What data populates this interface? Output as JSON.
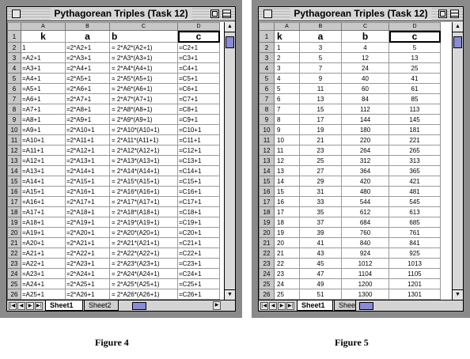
{
  "figures": [
    {
      "caption": "Figure 4",
      "window_title": "Pythagorean Triples (Task 12)",
      "column_letters": [
        "A",
        "B",
        "C",
        "D"
      ],
      "header_labels": [
        "k",
        "a",
        "b",
        "c"
      ],
      "tabs": [
        "Sheet1",
        "Sheet2"
      ],
      "rows": [
        [
          "1",
          "=2*A2+1",
          "= 2*A2*(A2+1)",
          "=C2+1"
        ],
        [
          "=A2+1",
          "=2*A3+1",
          "= 2*A3*(A3+1)",
          "=C3+1"
        ],
        [
          "=A3+1",
          "=2*A4+1",
          "= 2*A4*(A4+1)",
          "=C4+1"
        ],
        [
          "=A4+1",
          "=2*A5+1",
          "= 2*A5*(A5+1)",
          "=C5+1"
        ],
        [
          "=A5+1",
          "=2*A6+1",
          "= 2*A6*(A6+1)",
          "=C6+1"
        ],
        [
          "=A6+1",
          "=2*A7+1",
          "= 2*A7*(A7+1)",
          "=C7+1"
        ],
        [
          "=A7+1",
          "=2*A8+1",
          "= 2*A8*(A8+1)",
          "=C8+1"
        ],
        [
          "=A8+1",
          "=2*A9+1",
          "= 2*A9*(A9+1)",
          "=C9+1"
        ],
        [
          "=A9+1",
          "=2*A10+1",
          "= 2*A10*(A10+1)",
          "=C10+1"
        ],
        [
          "=A10+1",
          "=2*A11+1",
          "= 2*A11*(A11+1)",
          "=C11+1"
        ],
        [
          "=A11+1",
          "=2*A12+1",
          "= 2*A12*(A12+1)",
          "=C12+1"
        ],
        [
          "=A12+1",
          "=2*A13+1",
          "= 2*A13*(A13+1)",
          "=C13+1"
        ],
        [
          "=A13+1",
          "=2*A14+1",
          "= 2*A14*(A14+1)",
          "=C14+1"
        ],
        [
          "=A14+1",
          "=2*A15+1",
          "= 2*A15*(A15+1)",
          "=C15+1"
        ],
        [
          "=A15+1",
          "=2*A16+1",
          "= 2*A16*(A16+1)",
          "=C16+1"
        ],
        [
          "=A16+1",
          "=2*A17+1",
          "= 2*A17*(A17+1)",
          "=C17+1"
        ],
        [
          "=A17+1",
          "=2*A18+1",
          "= 2*A18*(A18+1)",
          "=C18+1"
        ],
        [
          "=A18+1",
          "=2*A19+1",
          "= 2*A19*(A19+1)",
          "=C19+1"
        ],
        [
          "=A19+1",
          "=2*A20+1",
          "= 2*A20*(A20+1)",
          "=C20+1"
        ],
        [
          "=A20+1",
          "=2*A21+1",
          "= 2*A21*(A21+1)",
          "=C21+1"
        ],
        [
          "=A21+1",
          "=2*A22+1",
          "= 2*A22*(A22+1)",
          "=C22+1"
        ],
        [
          "=A22+1",
          "=2*A23+1",
          "= 2*A23*(A23+1)",
          "=C23+1"
        ],
        [
          "=A23+1",
          "=2*A24+1",
          "= 2*A24*(A24+1)",
          "=C24+1"
        ],
        [
          "=A24+1",
          "=2*A25+1",
          "= 2*A25*(A25+1)",
          "=C25+1"
        ],
        [
          "=A25+1",
          "=2*A26+1",
          "= 2*A26*(A26+1)",
          "=C26+1"
        ],
        [
          "",
          "",
          "",
          ""
        ]
      ]
    },
    {
      "caption": "Figure 5",
      "window_title": "Pythagorean Triples (Task 12)",
      "column_letters": [
        "A",
        "B",
        "C",
        "D"
      ],
      "header_labels": [
        "k",
        "a",
        "b",
        "c"
      ],
      "tabs": [
        "Sheet1",
        "Sheet"
      ],
      "rows": [
        [
          "1",
          "3",
          "4",
          "5"
        ],
        [
          "2",
          "5",
          "12",
          "13"
        ],
        [
          "3",
          "7",
          "24",
          "25"
        ],
        [
          "4",
          "9",
          "40",
          "41"
        ],
        [
          "5",
          "11",
          "60",
          "61"
        ],
        [
          "6",
          "13",
          "84",
          "85"
        ],
        [
          "7",
          "15",
          "112",
          "113"
        ],
        [
          "8",
          "17",
          "144",
          "145"
        ],
        [
          "9",
          "19",
          "180",
          "181"
        ],
        [
          "10",
          "21",
          "220",
          "221"
        ],
        [
          "11",
          "23",
          "264",
          "265"
        ],
        [
          "12",
          "25",
          "312",
          "313"
        ],
        [
          "13",
          "27",
          "364",
          "365"
        ],
        [
          "14",
          "29",
          "420",
          "421"
        ],
        [
          "15",
          "31",
          "480",
          "481"
        ],
        [
          "16",
          "33",
          "544",
          "545"
        ],
        [
          "17",
          "35",
          "612",
          "613"
        ],
        [
          "18",
          "37",
          "684",
          "685"
        ],
        [
          "19",
          "39",
          "760",
          "761"
        ],
        [
          "20",
          "41",
          "840",
          "841"
        ],
        [
          "21",
          "43",
          "924",
          "925"
        ],
        [
          "22",
          "45",
          "1012",
          "1013"
        ],
        [
          "23",
          "47",
          "1104",
          "1105"
        ],
        [
          "24",
          "49",
          "1200",
          "1201"
        ],
        [
          "25",
          "51",
          "1300",
          "1301"
        ],
        [
          "",
          "",
          "",
          ""
        ]
      ]
    }
  ]
}
